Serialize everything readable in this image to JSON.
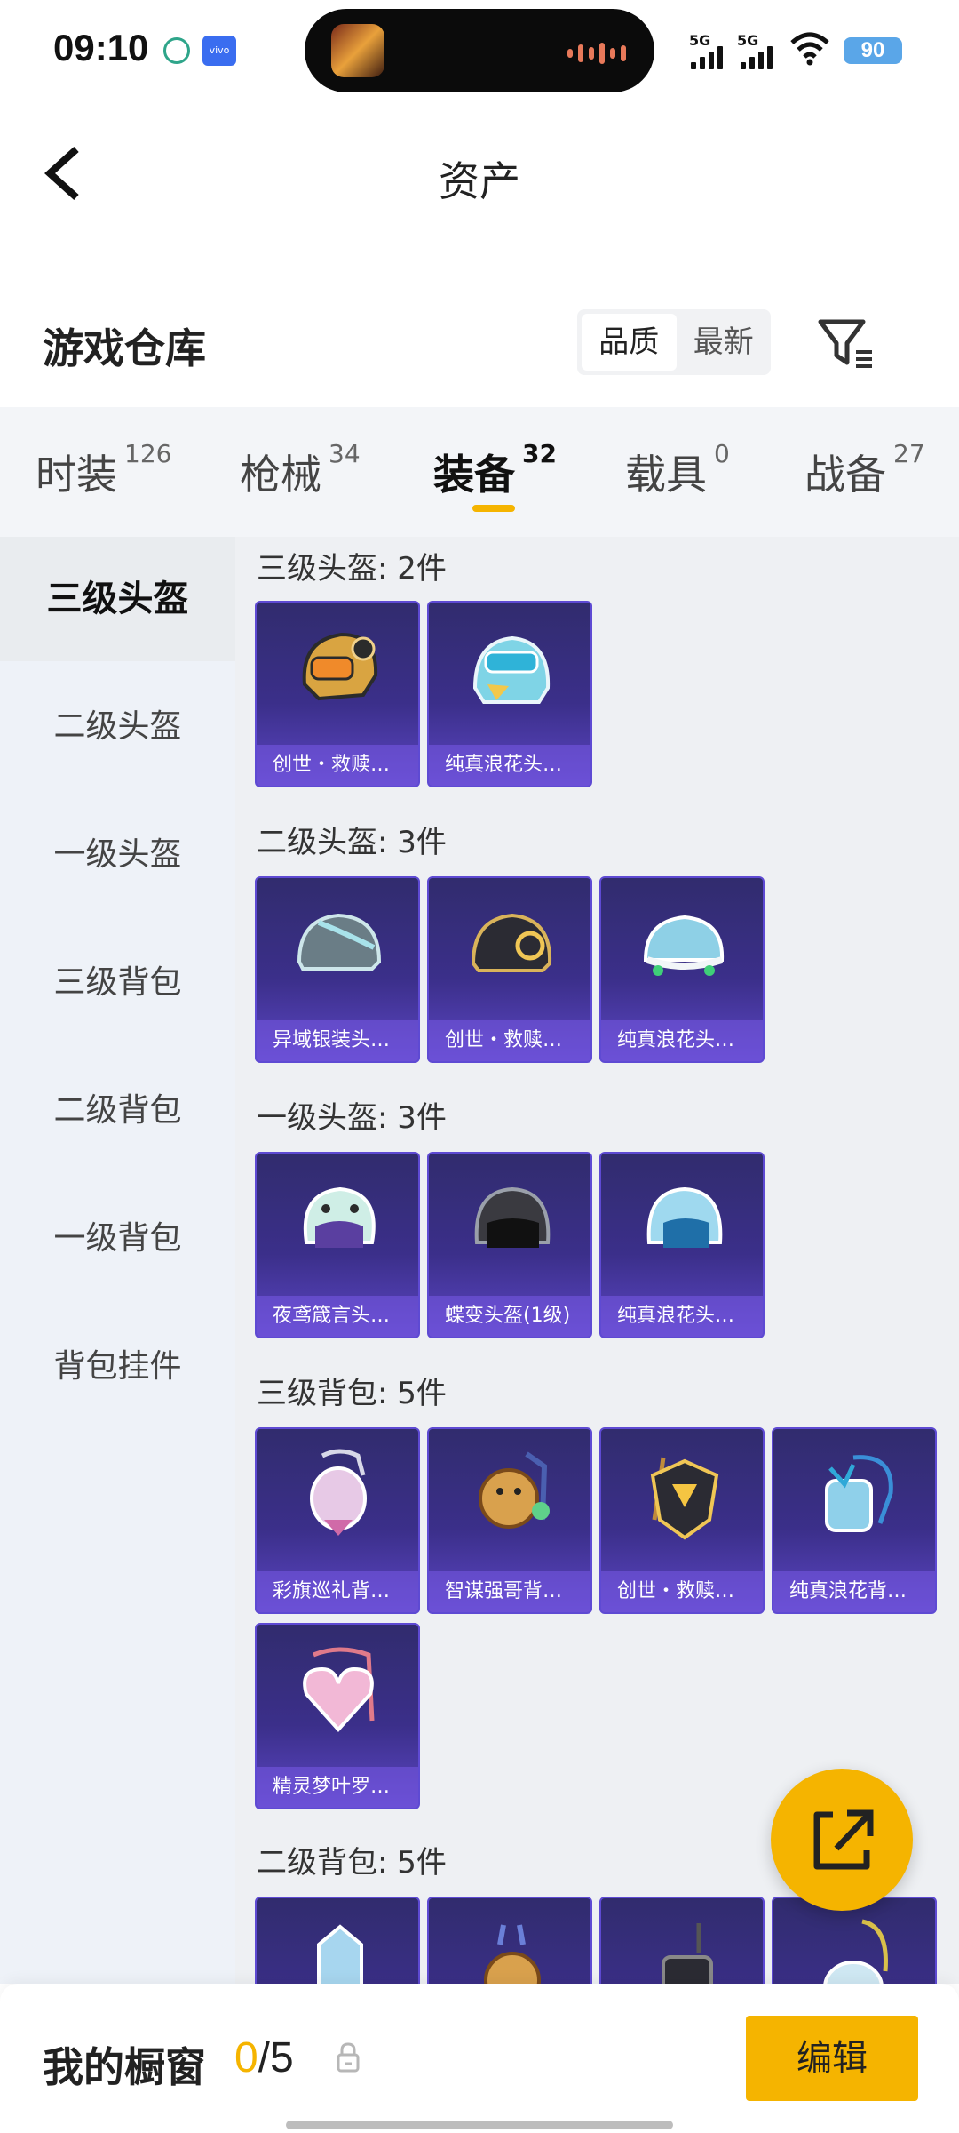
{
  "status": {
    "time": "09:10",
    "battery": "90",
    "net1": "5G",
    "net2": "5G",
    "app_badge": "vivo"
  },
  "header": {
    "title": "资产"
  },
  "section": {
    "title": "游戏仓库",
    "sort": [
      "品质",
      "最新"
    ]
  },
  "tabs": [
    {
      "label": "时装",
      "count": "126"
    },
    {
      "label": "枪械",
      "count": "34"
    },
    {
      "label": "装备",
      "count": "32"
    },
    {
      "label": "载具",
      "count": "0"
    },
    {
      "label": "战备",
      "count": "27"
    }
  ],
  "sidebar": [
    "三级头盔",
    "二级头盔",
    "一级头盔",
    "三级背包",
    "二级背包",
    "一级背包",
    "背包挂件"
  ],
  "groups": [
    {
      "title": "三级头盔: 2件",
      "items": [
        "创世・救赎…",
        "纯真浪花头…"
      ]
    },
    {
      "title": "二级头盔: 3件",
      "items": [
        "异域银装头…",
        "创世・救赎…",
        "纯真浪花头…"
      ]
    },
    {
      "title": "一级头盔: 3件",
      "items": [
        "夜鸢箴言头…",
        "蝶变头盔(1级)",
        "纯真浪花头…"
      ]
    },
    {
      "title": "三级背包: 5件",
      "items": [
        "彩旗巡礼背…",
        "智谋强哥背…",
        "创世・救赎…",
        "纯真浪花背…",
        "精灵梦叶罗…"
      ]
    },
    {
      "title": "二级背包: 5件",
      "items": []
    }
  ],
  "bottom": {
    "label": "我的橱窗",
    "current": "0",
    "total": "/5",
    "edit": "编辑"
  },
  "colors": {
    "accent": "#f5b400",
    "card": "#3b2f8a"
  }
}
